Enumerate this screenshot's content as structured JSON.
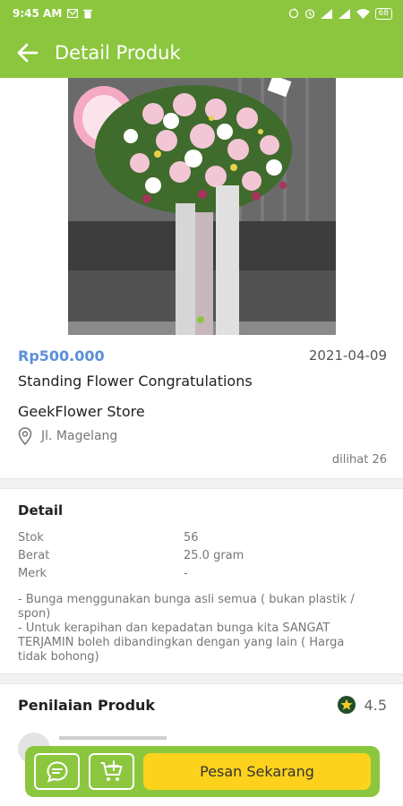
{
  "status_bar": {
    "time": "9:45 AM",
    "battery": "68"
  },
  "app_bar": {
    "title": "Detail Produk"
  },
  "product": {
    "price": "Rp500.000",
    "date": "2021-04-09",
    "name": "Standing Flower Congratulations",
    "store": "GeekFlower Store",
    "location": "Jl. Magelang",
    "views": "dilihat 26"
  },
  "detail": {
    "title": "Detail",
    "specs": [
      {
        "label": "Stok",
        "value": "56"
      },
      {
        "label": "Berat",
        "value": "25.0 gram"
      },
      {
        "label": "Merk",
        "value": "-"
      }
    ],
    "description": "- Bunga menggunakan bunga asli semua ( bukan plastik / spon)\n- Untuk kerapihan dan kepadatan bunga kita SANGAT TERJAMIN boleh dibandingkan dengan yang lain ( Harga tidak bohong)"
  },
  "rating": {
    "title": "Penilaian Produk",
    "value": "4.5"
  },
  "bottom_bar": {
    "order_label": "Pesan Sekarang"
  },
  "colors": {
    "brand_green": "#8cc63f",
    "price_blue": "#5b8fd6",
    "order_yellow": "#fcd21c"
  },
  "icons": [
    "back-arrow-icon",
    "chat-icon",
    "add-to-cart-icon",
    "location-pin-icon",
    "star-icon"
  ]
}
